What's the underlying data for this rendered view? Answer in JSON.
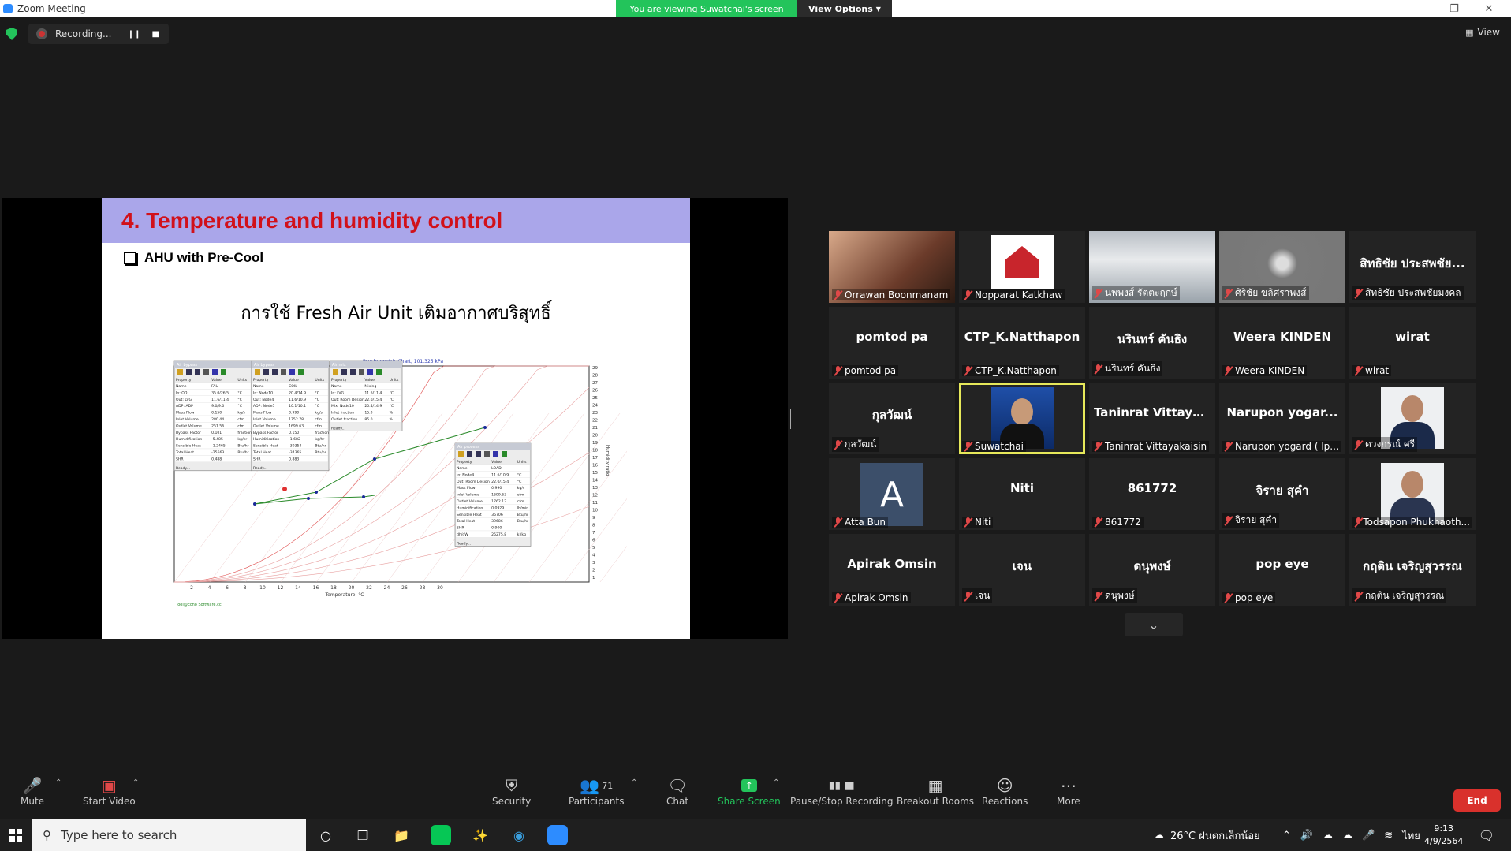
{
  "window": {
    "title": "Zoom Meeting"
  },
  "banner": {
    "viewing": "You are viewing Suwatchai's screen",
    "view_options": "View Options"
  },
  "recording": {
    "label": "Recording..."
  },
  "view_button": "View",
  "slide": {
    "title": "4. Temperature and humidity control",
    "subtitle": "AHU with Pre-Cool",
    "thai_caption": "การใช้ Fresh Air Unit เติมอากาศบริสุทธิ์"
  },
  "chart_data": {
    "type": "line",
    "title": "Psychrometric Chart, 101.325 kPa",
    "xlabel": "Temperature, °C",
    "ylabel": "Humidity ratio",
    "x_ticks": [
      "2",
      "4",
      "6",
      "8",
      "10",
      "12",
      "14",
      "16",
      "18",
      "20",
      "22",
      "24",
      "26",
      "28",
      "30"
    ],
    "y_ticks": [
      "1",
      "2",
      "3",
      "4",
      "5",
      "6",
      "7",
      "8",
      "9",
      "10",
      "11",
      "12",
      "13",
      "14",
      "15",
      "16",
      "17",
      "18",
      "19",
      "20",
      "21",
      "22",
      "23",
      "24",
      "25",
      "26",
      "27",
      "28",
      "29"
    ],
    "footer": "Tool@Echo Software.cc"
  },
  "dialogs": [
    {
      "title": "Air bypass",
      "rows": [
        [
          "Name",
          "FAU",
          ""
        ],
        [
          "In: OD",
          "35.0/26.5",
          "°C"
        ],
        [
          "Out: LVG",
          "11.6/11.4",
          "°C"
        ],
        [
          "ADP: ADP",
          "9.0/9.0",
          "°C"
        ],
        [
          "Mass Flow",
          "0.150",
          "kg/s"
        ],
        [
          "Inlet Volume",
          "280.44",
          "cfm"
        ],
        [
          "Outlet Volume",
          "257.56",
          "cfm"
        ],
        [
          "Bypass Factor",
          "0.101",
          "fraction"
        ],
        [
          "Humidification",
          "-5.485",
          "kg/hr"
        ],
        [
          "Sensible Heat",
          "-1.2465",
          "Btu/hr"
        ],
        [
          "Total Heat",
          "-25563",
          "Btu/hr"
        ],
        [
          "SHR",
          "0.488",
          ""
        ]
      ]
    },
    {
      "title": "Air bypass",
      "rows": [
        [
          "Name",
          "COIL",
          ""
        ],
        [
          "In: Node10",
          "20.4/14.9",
          "°C"
        ],
        [
          "Out: Node4",
          "11.6/10.9",
          "°C"
        ],
        [
          "ADP: Node5",
          "10.1/10.1",
          "°C"
        ],
        [
          "Mass Flow",
          "0.990",
          "kg/s"
        ],
        [
          "Inlet Volume",
          "1752.78",
          "cfm"
        ],
        [
          "Outlet Volume",
          "1699.63",
          "cfm"
        ],
        [
          "Bypass Factor",
          "0.150",
          "fraction"
        ],
        [
          "Humidification",
          "-1.682",
          "kg/hr"
        ],
        [
          "Sensible Heat",
          "-30354",
          "Btu/hr"
        ],
        [
          "Total Heat",
          "-34365",
          "Btu/hr"
        ],
        [
          "SHR",
          "0.883",
          ""
        ]
      ]
    },
    {
      "title": "Air mix",
      "rows": [
        [
          "Name",
          "Mixing",
          ""
        ],
        [
          "In: LVG",
          "11.6/11.4",
          "°C"
        ],
        [
          "Out: Room Design",
          "22.0/15.4",
          "°C"
        ],
        [
          "Mix: Node10",
          "20.4/14.9",
          "°C"
        ],
        [
          "Inlet fraction",
          "15.0",
          "%"
        ],
        [
          "Outlet fraction",
          "85.0",
          "%"
        ]
      ]
    },
    {
      "title": "Air process",
      "rows": [
        [
          "Name",
          "LOAD",
          ""
        ],
        [
          "In: Node4",
          "11.6/10.9",
          "°C"
        ],
        [
          "Out: Room Design",
          "22.0/15.4",
          "°C"
        ],
        [
          "Mass Flow",
          "0.990",
          "kg/s"
        ],
        [
          "Inlet Volume",
          "1699.63",
          "cfm"
        ],
        [
          "Outlet Volume",
          "1762.12",
          "cfm"
        ],
        [
          "Humidification",
          "0.0929",
          "lb/min"
        ],
        [
          "Sensible Heat",
          "35706",
          "Btu/hr"
        ],
        [
          "Total Heat",
          "39686",
          "Btu/hr"
        ],
        [
          "SHR",
          "0.900",
          ""
        ],
        [
          "dh/dW",
          "25275.8",
          "kJ/kg"
        ]
      ]
    }
  ],
  "participants": [
    {
      "big": "",
      "name": "Orrawan Boonmanam",
      "type": "photo-woman"
    },
    {
      "big": "",
      "name": "Nopparat Katkhaw",
      "type": "logo"
    },
    {
      "big": "",
      "name": "นพพงส์ รัตตะฤกษ์",
      "type": "photo-office"
    },
    {
      "big": "",
      "name": "ศิริชัย ขลิศราพงส์",
      "type": "photo-grey"
    },
    {
      "big": "สิทธิชัย ประสพชัย...",
      "name": "สิทธิชัย ประสพชัยมงคล",
      "type": "name"
    },
    {
      "big": "pomtod pa",
      "name": "pomtod pa",
      "type": "name"
    },
    {
      "big": "CTP_K.Natthapon",
      "name": "CTP_K.Natthapon",
      "type": "name"
    },
    {
      "big": "นรินทร์ คันธิง",
      "name": "นรินทร์ คันธิง",
      "type": "name"
    },
    {
      "big": "Weera KINDEN",
      "name": "Weera KINDEN",
      "type": "name"
    },
    {
      "big": "wirat",
      "name": "wirat",
      "type": "name"
    },
    {
      "big": "กุลวัฒน์",
      "name": "กุลวัฒน์",
      "type": "name"
    },
    {
      "big": "",
      "name": "Suwatchai",
      "type": "photo-speaker"
    },
    {
      "big": "Taninrat Vittaya...",
      "name": "Taninrat Vittayakaisin",
      "type": "name"
    },
    {
      "big": "Narupon yogar...",
      "name": "Narupon yogard ( lp...",
      "type": "name"
    },
    {
      "big": "",
      "name": "ดวงกรณ์ ศรี",
      "type": "photo-man1"
    },
    {
      "big": "",
      "name": "Atta Bun",
      "type": "avatar",
      "initial": "A"
    },
    {
      "big": "Niti",
      "name": "Niti",
      "type": "name"
    },
    {
      "big": "861772",
      "name": "861772",
      "type": "name"
    },
    {
      "big": "จิราย สุคำ",
      "name": "จิราย สุคำ",
      "type": "name"
    },
    {
      "big": "",
      "name": "Todsapon Phukhaoth...",
      "type": "photo-man2"
    },
    {
      "big": "Apirak Omsin",
      "name": "Apirak Omsin",
      "type": "name"
    },
    {
      "big": "เจน",
      "name": "เจน",
      "type": "name"
    },
    {
      "big": "ดนุพงษ์",
      "name": "ดนุพงษ์",
      "type": "name"
    },
    {
      "big": "pop eye",
      "name": "pop eye",
      "type": "name"
    },
    {
      "big": "กฤติน เจริญสุวรรณ",
      "name": "กฤติน เจริญสุวรรณ",
      "type": "name"
    }
  ],
  "toolbar": {
    "mute": "Mute",
    "start_video": "Start Video",
    "security": "Security",
    "participants": "Participants",
    "participants_count": "71",
    "chat": "Chat",
    "share_screen": "Share Screen",
    "pause_stop": "Pause/Stop Recording",
    "breakout": "Breakout Rooms",
    "reactions": "Reactions",
    "more": "More",
    "end": "End"
  },
  "taskbar": {
    "search_placeholder": "Type here to search",
    "weather": "26°C  ฝนตกเล็กน้อย",
    "lang": "ไทย",
    "time": "9:13",
    "date": "4/9/2564"
  }
}
